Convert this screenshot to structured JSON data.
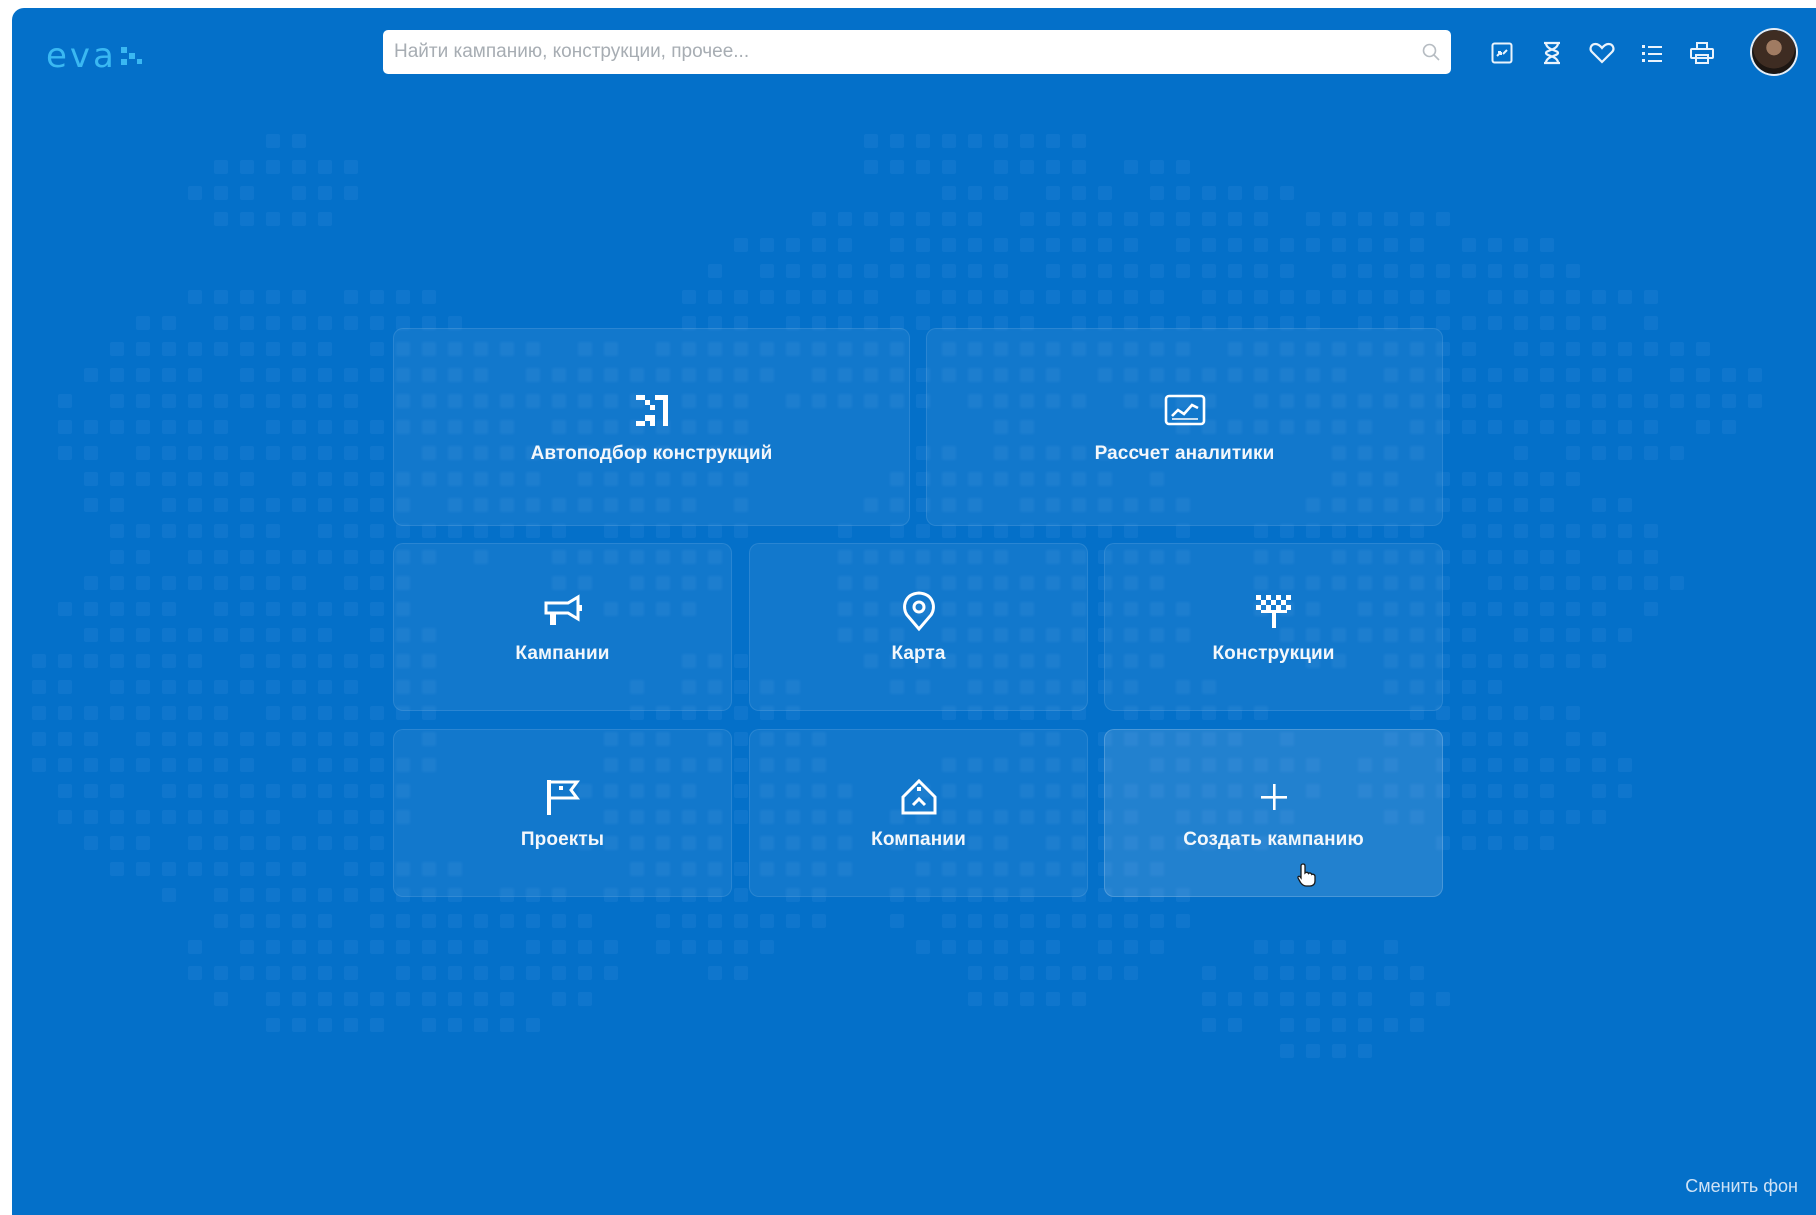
{
  "brand": {
    "logo_text": "eva"
  },
  "search": {
    "placeholder": "Найти кампанию, конструкции, прочее..."
  },
  "toolbar": {
    "icons": [
      "switch-icon",
      "hourglass-icon",
      "heart-icon",
      "list-icon",
      "printer-icon"
    ]
  },
  "tiles": {
    "autoselect": {
      "label": "Автоподбор конструкций",
      "icon": "shuffle-icon"
    },
    "analytics": {
      "label": "Рассчет аналитики",
      "icon": "chart-icon"
    },
    "campaigns": {
      "label": "Кампании",
      "icon": "megaphone-icon"
    },
    "map": {
      "label": "Карта",
      "icon": "map-pin-icon"
    },
    "constructions": {
      "label": "Конструкции",
      "icon": "billboard-icon"
    },
    "projects": {
      "label": "Проекты",
      "icon": "flag-icon"
    },
    "companies": {
      "label": "Компании",
      "icon": "building-icon"
    },
    "create_campaign": {
      "label": "Создать кампанию",
      "icon": "plus-icon"
    }
  },
  "footer": {
    "change_background": "Сменить фон"
  },
  "colors": {
    "background": "#0470c9",
    "logo": "#3ab8f2",
    "tile_text": "#f3f7fb"
  }
}
